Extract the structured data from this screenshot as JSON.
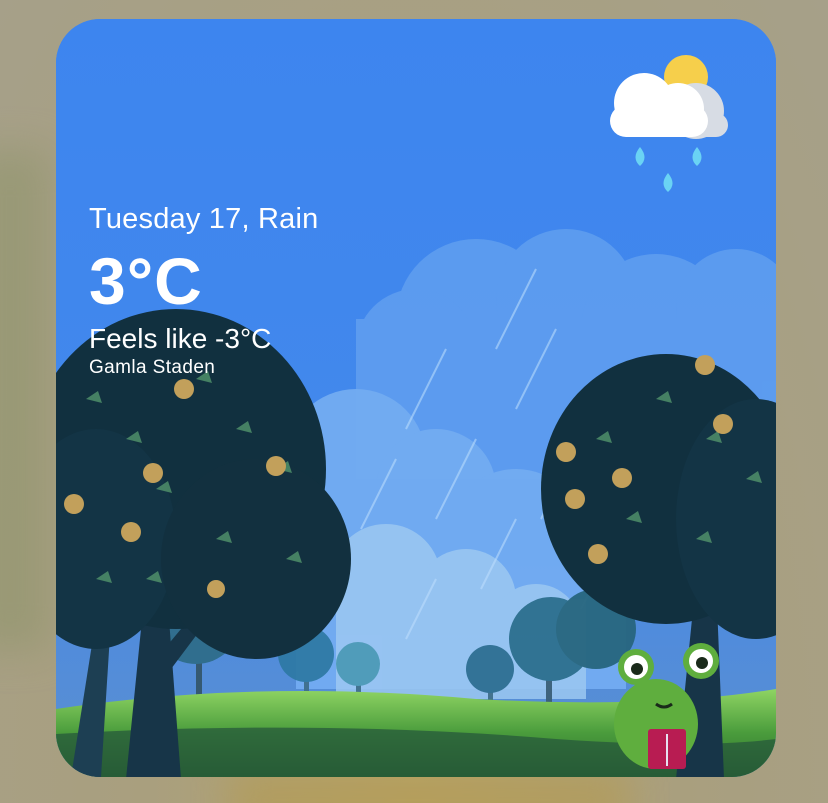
{
  "widget": {
    "date_condition": "Tuesday 17, Rain",
    "temperature": "3°C",
    "feels_like": "Feels like -3°C",
    "location": "Gamla Staden",
    "condition_icon": "rain-partly-cloudy-icon",
    "illustration": "frog-reading-under-trees-in-rain",
    "colors": {
      "sky": "#3f86ee",
      "tree_dark": "#123040",
      "grass": "#6ec24f",
      "frog": "#5fae3e",
      "sun": "#f6cf4b",
      "raindrop": "#6ad3f4"
    }
  }
}
